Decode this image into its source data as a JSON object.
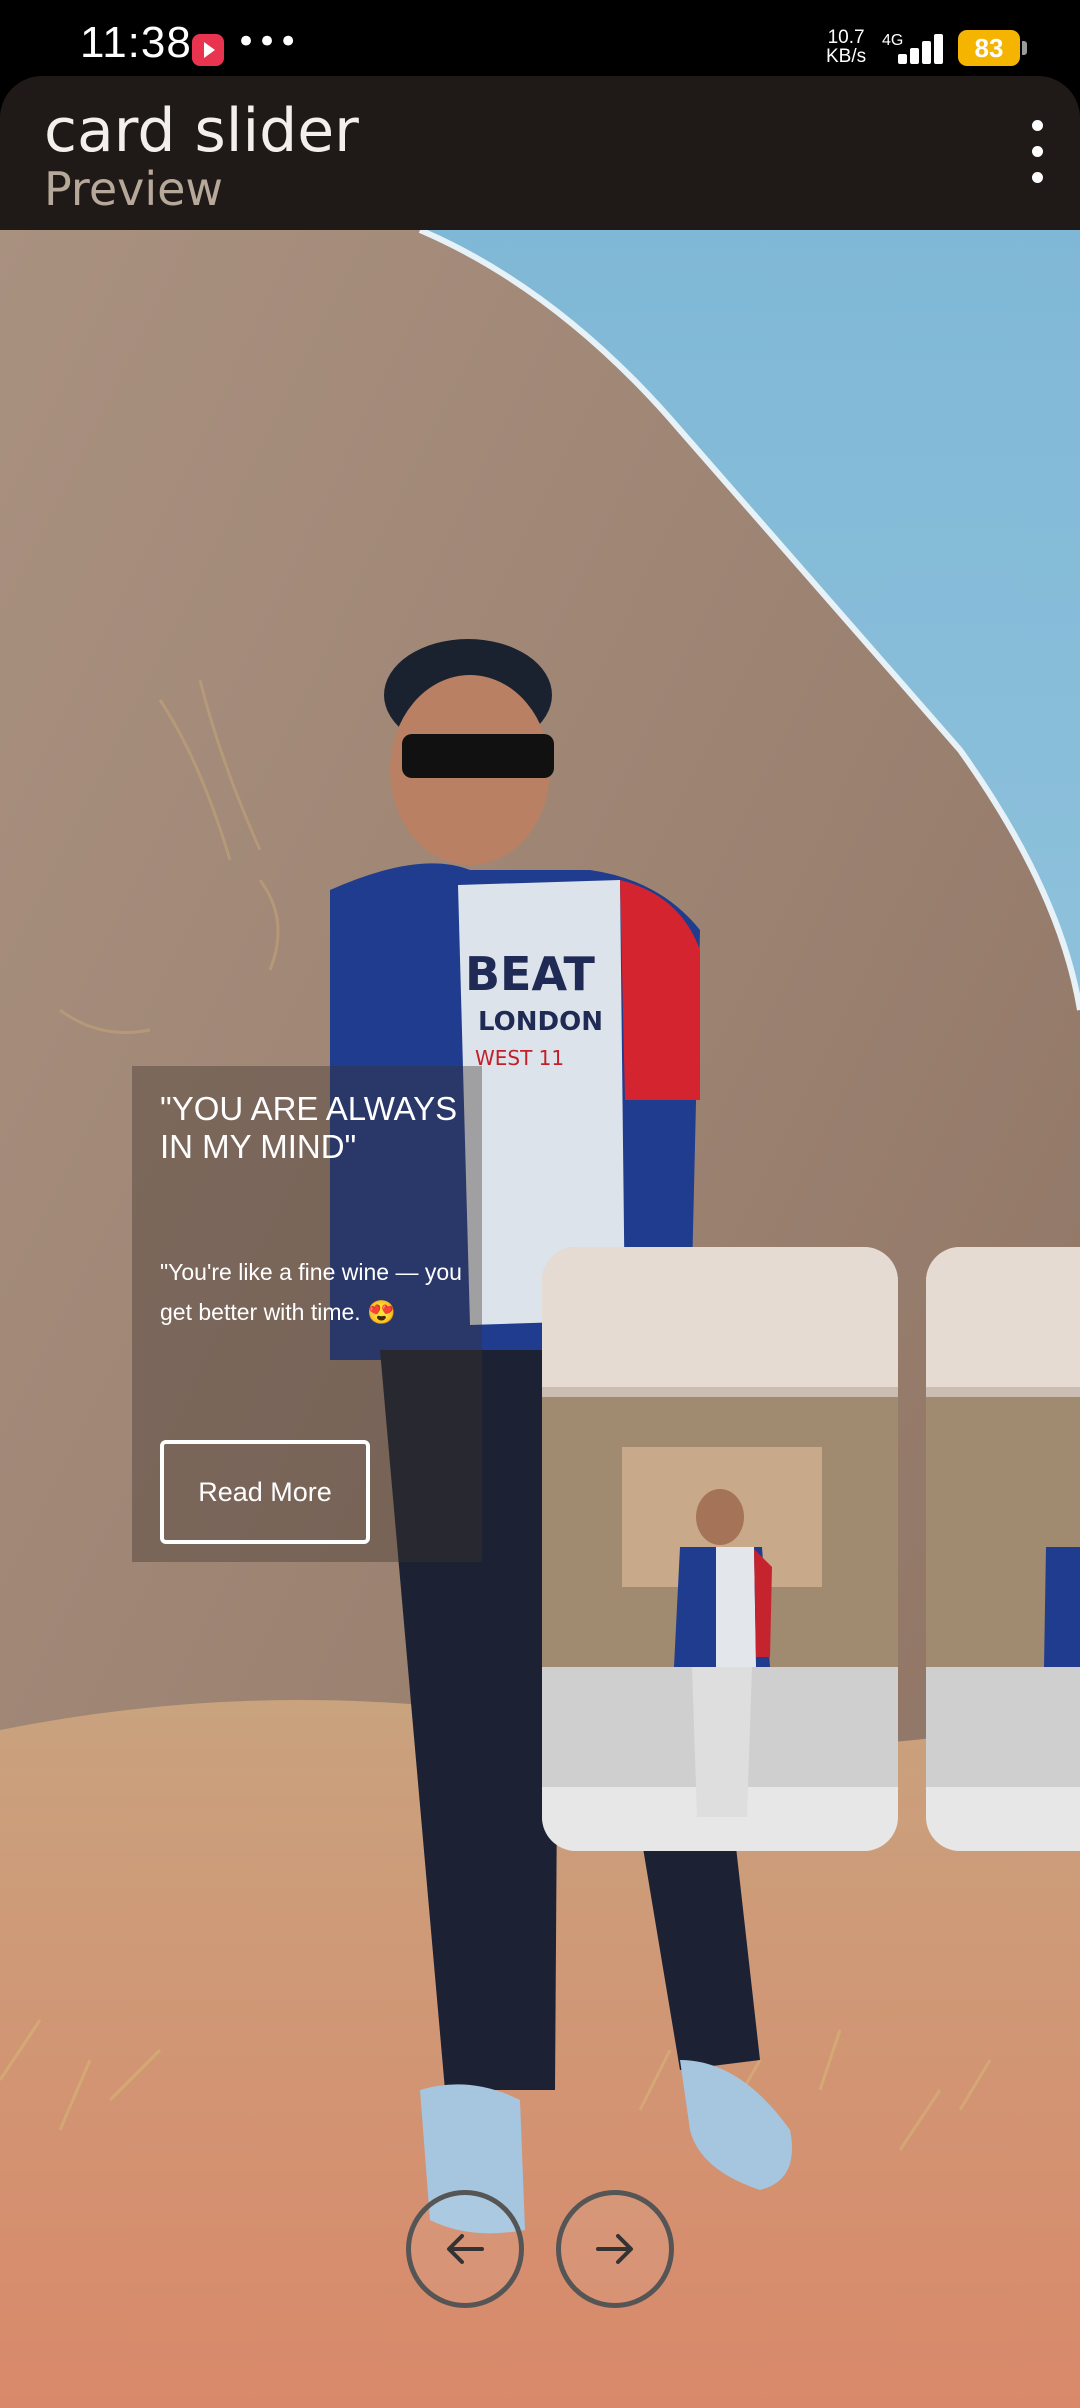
{
  "status_bar": {
    "time": "11:38",
    "more": "•••",
    "speed_value": "10.7",
    "speed_unit": "KB/s",
    "network": "4G",
    "battery": "83",
    "battery_color": "#f4b400",
    "app_icon": "video-app-icon"
  },
  "app_bar": {
    "title": "card slider",
    "subtitle": "Preview",
    "menu_icon": "overflow-menu-icon"
  },
  "card": {
    "heading": "\"YOU ARE ALWAYS IN MY MIND\"",
    "body": "\"You're like a fine wine — you get better with time. 😍",
    "button_label": "Read More"
  },
  "navigation": {
    "prev_icon": "arrow-left-icon",
    "next_icon": "arrow-right-icon"
  }
}
